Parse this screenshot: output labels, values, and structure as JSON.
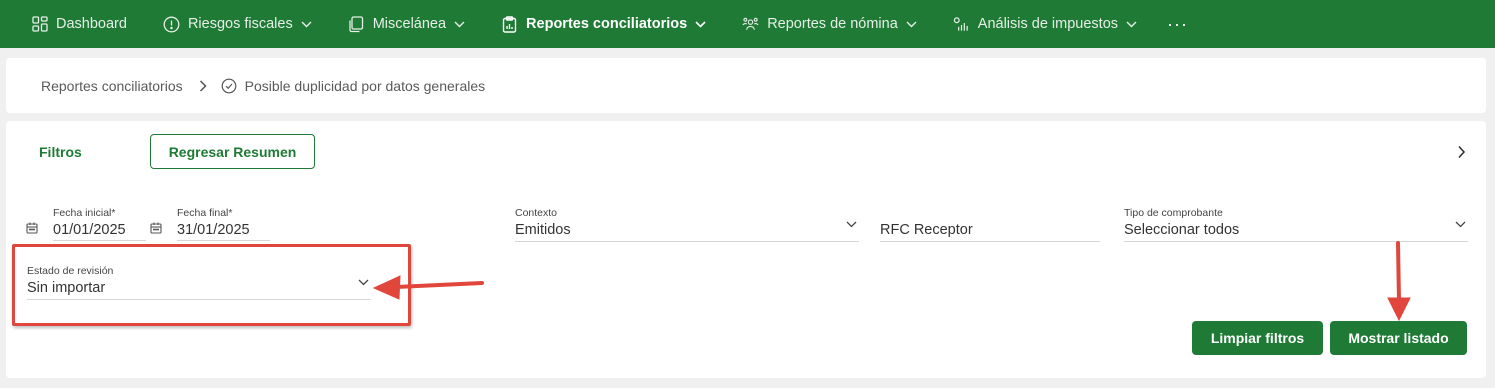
{
  "nav": {
    "items": [
      {
        "label": "Dashboard",
        "icon": "dashboard-icon",
        "has_chevron": false,
        "active": false
      },
      {
        "label": "Riesgos fiscales",
        "icon": "alert-circle-icon",
        "has_chevron": true,
        "active": false
      },
      {
        "label": "Miscelánea",
        "icon": "copy-icon",
        "has_chevron": true,
        "active": false
      },
      {
        "label": "Reportes conciliatorios",
        "icon": "clipboard-icon",
        "has_chevron": true,
        "active": true
      },
      {
        "label": "Reportes de nómina",
        "icon": "people-icon",
        "has_chevron": true,
        "active": false
      },
      {
        "label": "Análisis de impuestos",
        "icon": "chart-icon",
        "has_chevron": true,
        "active": false
      }
    ],
    "more": "···"
  },
  "breadcrumb": {
    "parent": "Reportes conciliatorios",
    "current": "Posible duplicidad por datos generales"
  },
  "filters": {
    "title": "Filtros",
    "back_button": "Regresar Resumen",
    "fecha_inicial": {
      "label": "Fecha inicial*",
      "value": "01/01/2025"
    },
    "fecha_final": {
      "label": "Fecha final*",
      "value": "31/01/2025"
    },
    "contexto": {
      "label": "Contexto",
      "value": "Emitidos"
    },
    "rfc_receptor": {
      "placeholder": "RFC Receptor"
    },
    "tipo_comprobante": {
      "label": "Tipo de comprobante",
      "value": "Seleccionar todos"
    },
    "estado_revision": {
      "label": "Estado de revisión",
      "value": "Sin importar"
    },
    "clear_button": "Limpiar filtros",
    "show_button": "Mostrar listado"
  },
  "colors": {
    "brand_green": "#1e7a34",
    "annotation_red": "#e0463c"
  }
}
